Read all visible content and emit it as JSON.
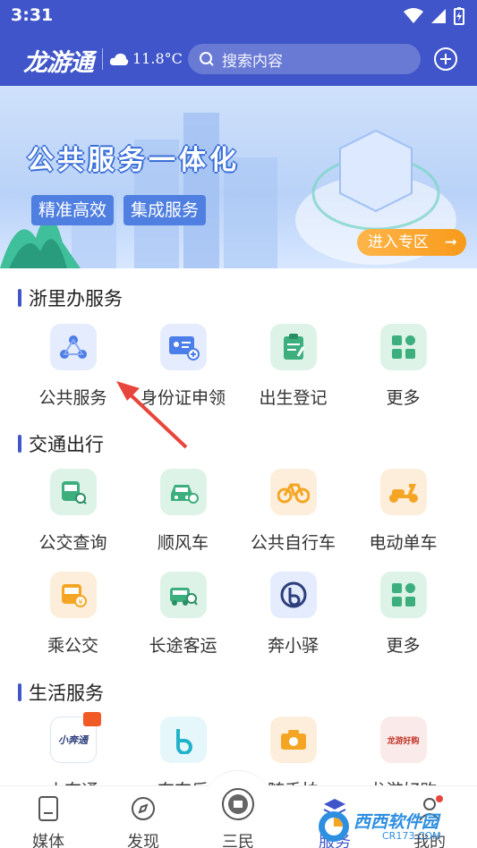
{
  "status_bar": {
    "time": "3:31"
  },
  "header": {
    "logo": "龙游通",
    "temperature": "11.8°C",
    "search_placeholder": "搜索内容"
  },
  "banner": {
    "title": "公共服务一体化",
    "tags": [
      "精准高效",
      "集成服务"
    ],
    "enter_label": "进入专区"
  },
  "sections": [
    {
      "title": "浙里办服务",
      "items": [
        {
          "label": "公共服务",
          "icon": "public-service-icon"
        },
        {
          "label": "身份证申领",
          "icon": "id-card-icon"
        },
        {
          "label": "出生登记",
          "icon": "birth-register-icon"
        },
        {
          "label": "更多",
          "icon": "more-grid-icon"
        }
      ]
    },
    {
      "title": "交通出行",
      "items": [
        {
          "label": "公交查询",
          "icon": "bus-search-icon"
        },
        {
          "label": "顺风车",
          "icon": "carpool-icon"
        },
        {
          "label": "公共自行车",
          "icon": "bicycle-icon"
        },
        {
          "label": "电动单车",
          "icon": "e-scooter-icon"
        },
        {
          "label": "乘公交",
          "icon": "ride-bus-icon"
        },
        {
          "label": "长途客运",
          "icon": "coach-icon"
        },
        {
          "label": "奔小驿",
          "icon": "ben-xiaoyi-icon"
        },
        {
          "label": "更多",
          "icon": "more-grid-icon"
        }
      ]
    },
    {
      "title": "生活服务",
      "items": [
        {
          "label": "小奔通",
          "icon": "xiaobentong-icon",
          "badge": "小奔通"
        },
        {
          "label": "奔奔乐",
          "icon": "benbenle-icon"
        },
        {
          "label": "随手拍",
          "icon": "camera-icon"
        },
        {
          "label": "龙游好购",
          "icon": "longyou-shop-icon",
          "badge": "龙游好购"
        }
      ]
    }
  ],
  "bottom_nav": [
    {
      "label": "媒体",
      "icon": "document-icon"
    },
    {
      "label": "发现",
      "icon": "compass-icon"
    },
    {
      "label": "三民",
      "icon": "sanmin-icon"
    },
    {
      "label": "服务",
      "icon": "service-icon"
    },
    {
      "label": "我的",
      "icon": "profile-icon"
    }
  ],
  "watermark": {
    "text": "西西软件园",
    "sub": "CR173.COM"
  },
  "colors": {
    "brand": "#3f55c9",
    "tile_blue": "#e4ecfd",
    "tile_green": "#def3e8",
    "tile_orange": "#fdeedb",
    "accent_orange": "#f89a1a"
  }
}
